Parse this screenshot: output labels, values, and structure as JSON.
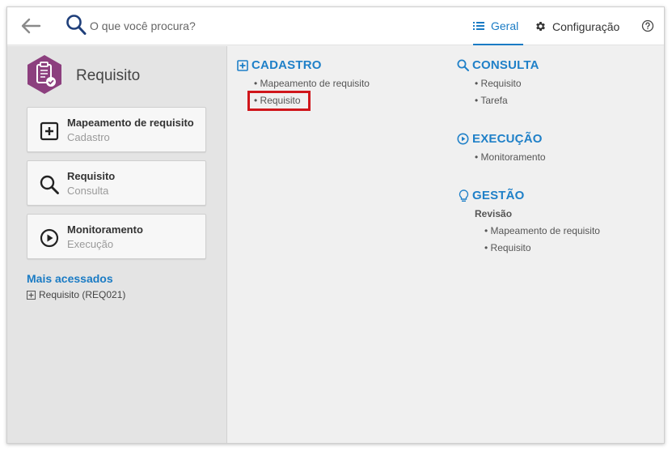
{
  "search": {
    "placeholder": "O que você procura?"
  },
  "tabs": [
    {
      "label": "Geral",
      "icon": "list-icon",
      "active": true
    },
    {
      "label": "Configuração",
      "icon": "gear-icon",
      "active": false
    }
  ],
  "colors": {
    "accent": "#1a7bc4",
    "module": "#8c3f7e",
    "highlight": "#d0161b"
  },
  "module": {
    "title": "Requisito",
    "icon": "clipboard-check-icon"
  },
  "shortcuts": [
    {
      "title": "Mapeamento de requisito",
      "subtitle": "Cadastro",
      "icon": "plus-square-icon"
    },
    {
      "title": "Requisito",
      "subtitle": "Consulta",
      "icon": "search-icon"
    },
    {
      "title": "Monitoramento",
      "subtitle": "Execução",
      "icon": "play-circle-icon"
    }
  ],
  "mais_acessados": {
    "title": "Mais acessados",
    "items": [
      {
        "label": "Requisito (REQ021)",
        "icon": "plus-square-icon"
      }
    ]
  },
  "sections": {
    "cadastro": {
      "title": "CADASTRO",
      "icon": "plus-square-icon",
      "items": [
        "• Mapeamento de requisito",
        "• Requisito"
      ]
    },
    "consulta": {
      "title": "CONSULTA",
      "icon": "search-icon",
      "items": [
        "• Requisito",
        "• Tarefa"
      ]
    },
    "execucao": {
      "title": "EXECUÇÃO",
      "icon": "play-circle-icon",
      "items": [
        "• Monitoramento"
      ]
    },
    "gestao": {
      "title": "GESTÃO",
      "icon": "lightbulb-icon",
      "subheading": "Revisão",
      "items": [
        "• Mapeamento de requisito",
        "• Requisito"
      ]
    }
  }
}
